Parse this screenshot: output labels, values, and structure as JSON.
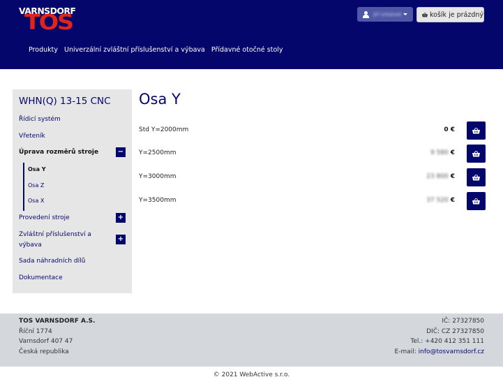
{
  "brand": {
    "logo_word": "VARNSDORF",
    "logo_mark": "TOS",
    "logo_color": "#e2231a",
    "primary_color": "#05066b"
  },
  "header": {
    "user": {
      "icon": "user-icon",
      "name": "Jiří Urbánek"
    },
    "cart": {
      "icon": "basket-icon",
      "label": "košík je prázdný"
    }
  },
  "nav": {
    "items": [
      "Produkty",
      "Univerzální zvláštní příslušenství a výbava",
      "Přídavné otočné stoly"
    ]
  },
  "sidebar": {
    "title": "WHN(Q) 13-15 CNC",
    "items": [
      {
        "label": "Řídicí systém"
      },
      {
        "label": "Vřeteník"
      },
      {
        "label": "Úprava rozměrů stroje",
        "toggle": "−",
        "active": true
      },
      {
        "label": "Provedení stroje",
        "toggle": "+"
      },
      {
        "label": "Zvláštní příslušenství a výbava",
        "toggle": "+"
      },
      {
        "label": "Sada náhradních dílů"
      },
      {
        "label": "Dokumentace"
      }
    ],
    "subitems": [
      {
        "label": "Osa Y",
        "active": true
      },
      {
        "label": "Osa Z"
      },
      {
        "label": "Osa X"
      }
    ]
  },
  "main": {
    "title": "Osa Y",
    "products": [
      {
        "name": "Std Y=2000mm",
        "price_hidden": "",
        "currency": "0 €"
      },
      {
        "name": "Y=2500mm",
        "price_hidden": "9 580",
        "currency": "€"
      },
      {
        "name": "Y=3000mm",
        "price_hidden": "23 800",
        "currency": "€"
      },
      {
        "name": "Y=3500mm",
        "price_hidden": "37 520",
        "currency": "€"
      }
    ]
  },
  "footer": {
    "company": "TOS VARNSDORF A.S.",
    "address": [
      "Říční 1774",
      "Varnsdorf 407 47",
      "Česká republika"
    ],
    "contact": {
      "ic": "IČ: 27327850",
      "dic": "DIČ: CZ 27327850",
      "tel": "Tel.: +420 412 351 111",
      "email_label": "E-mail:",
      "email": "info@tosvarnsdorf.cz"
    },
    "copyright": "© 2021 WebActive s.r.o."
  }
}
